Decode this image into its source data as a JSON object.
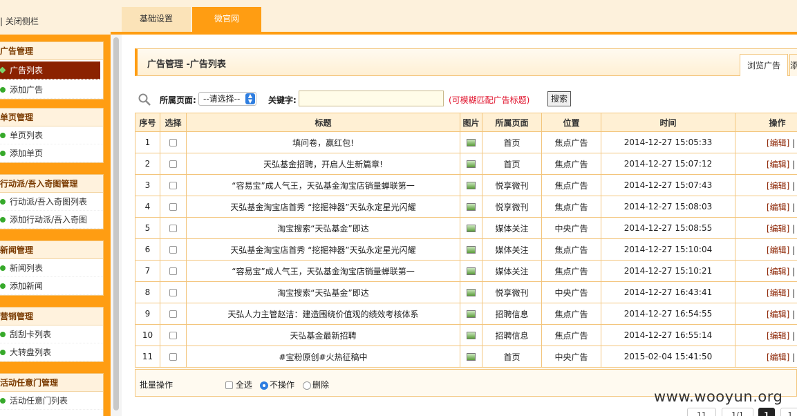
{
  "topbar": {
    "close_sidebar": "| 关闭侧栏",
    "tabs": [
      {
        "label": "基础设置"
      },
      {
        "label": "微官网"
      }
    ]
  },
  "sidebar": {
    "groups": [
      {
        "title": "广告管理",
        "items": [
          "广告列表",
          "添加广告"
        ]
      },
      {
        "title": "单页管理",
        "items": [
          "单页列表",
          "添加单页"
        ]
      },
      {
        "title": "行动派/吾入奇图管理",
        "items": [
          "行动派/吾入奇图列表",
          "添加行动派/吾入奇图"
        ]
      },
      {
        "title": "新闻管理",
        "items": [
          "新闻列表",
          "添加新闻"
        ]
      },
      {
        "title": "营销管理",
        "items": [
          "刮刮卡列表",
          "大转盘列表"
        ]
      },
      {
        "title": "活动任意门管理",
        "items": [
          "活动任意门列表"
        ]
      }
    ]
  },
  "main": {
    "title": "广告管理 -广告列表",
    "tab_browse": "浏览广告",
    "tab_next": "添",
    "search": {
      "page_label": "所属页面:",
      "page_select_value": "--请选择--",
      "keyword_label": "关键字:",
      "keyword_value": "",
      "hint": "(可模糊匹配广告标题)",
      "search_button": "搜索"
    },
    "table": {
      "headers": [
        "序号",
        "选择",
        "标题",
        "图片",
        "所属页面",
        "位置",
        "时间",
        "操作"
      ],
      "edit_label": "[编辑]",
      "rows": [
        {
          "no": "1",
          "title": "填问卷，赢红包!",
          "page": "首页",
          "position": "焦点广告",
          "time": "2014-12-27 15:05:33"
        },
        {
          "no": "2",
          "title": "天弘基金招聘，开启人生新篇章!",
          "page": "首页",
          "position": "焦点广告",
          "time": "2014-12-27 15:07:12"
        },
        {
          "no": "3",
          "title": "“容易宝”成人气王，天弘基金淘宝店销量蝉联第一",
          "page": "悦享微刊",
          "position": "焦点广告",
          "time": "2014-12-27 15:07:43"
        },
        {
          "no": "4",
          "title": "天弘基金淘宝店首秀 “挖掘神器”天弘永定星光闪耀",
          "page": "悦享微刊",
          "position": "焦点广告",
          "time": "2014-12-27 15:08:03"
        },
        {
          "no": "5",
          "title": "淘宝搜索“天弘基金”即达",
          "page": "媒体关注",
          "position": "中央广告",
          "time": "2014-12-27 15:08:55"
        },
        {
          "no": "6",
          "title": "天弘基金淘宝店首秀 “挖掘神器”天弘永定星光闪耀",
          "page": "媒体关注",
          "position": "焦点广告",
          "time": "2014-12-27 15:10:04"
        },
        {
          "no": "7",
          "title": "“容易宝”成人气王，天弘基金淘宝店销量蝉联第一",
          "page": "媒体关注",
          "position": "焦点广告",
          "time": "2014-12-27 15:10:21"
        },
        {
          "no": "8",
          "title": "淘宝搜索“天弘基金”即达",
          "page": "悦享微刊",
          "position": "中央广告",
          "time": "2014-12-27 16:43:41"
        },
        {
          "no": "9",
          "title": "天弘人力主管赵洁：建造围绕价值观的绩效考核体系",
          "page": "招聘信息",
          "position": "焦点广告",
          "time": "2014-12-27 16:54:55"
        },
        {
          "no": "10",
          "title": "天弘基金最新招聘",
          "page": "招聘信息",
          "position": "焦点广告",
          "time": "2014-12-27 16:55:14"
        },
        {
          "no": "11",
          "title": "#宝粉原创#火热征稿中",
          "page": "首页",
          "position": "中央广告",
          "time": "2015-02-04 15:41:50"
        }
      ]
    },
    "batch": {
      "label": "批量操作",
      "select_all": "全选",
      "no_action": "不操作",
      "delete": "删除"
    },
    "pagination": {
      "total": "11",
      "pages": "1/1",
      "current": "1",
      "next": "1"
    }
  },
  "watermark": "www.wooyun.org",
  "colors": {
    "accent": "#ff9d12",
    "active_item": "#8b2200",
    "hint": "#e0102a"
  }
}
